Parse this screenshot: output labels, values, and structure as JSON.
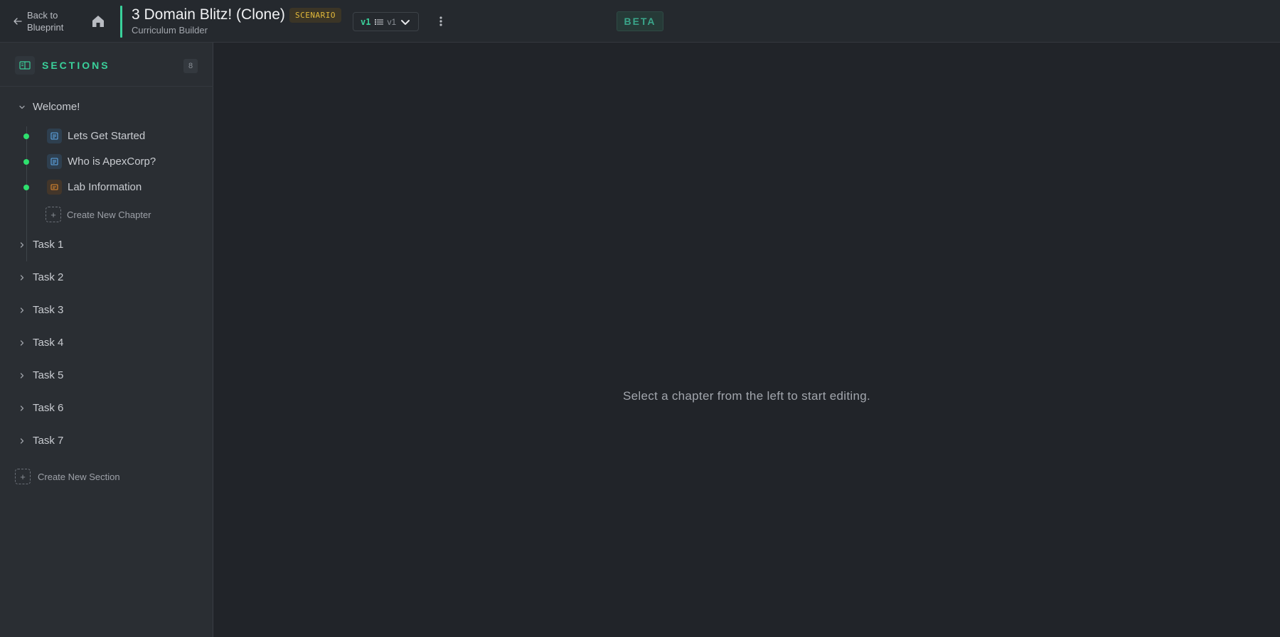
{
  "header": {
    "back_label": "Back to Blueprint",
    "title": "3 Domain Blitz! (Clone)",
    "badge": "SCENARIO",
    "subtitle": "Curriculum Builder",
    "version_current": "v1",
    "version_label": "v1",
    "beta_label": "BETA"
  },
  "sidebar": {
    "title": "SECTIONS",
    "count": "8",
    "sections": [
      {
        "label": "Welcome!",
        "expanded": true
      },
      {
        "label": "Task 1"
      },
      {
        "label": "Task 2"
      },
      {
        "label": "Task 3"
      },
      {
        "label": "Task 4"
      },
      {
        "label": "Task 5"
      },
      {
        "label": "Task 6"
      },
      {
        "label": "Task 7"
      }
    ],
    "chapters": [
      {
        "label": "Lets Get Started",
        "icon": "document-icon"
      },
      {
        "label": "Who is ApexCorp?",
        "icon": "document-icon"
      },
      {
        "label": "Lab Information",
        "icon": "lab-icon"
      }
    ],
    "create_chapter": "Create New Chapter",
    "create_section": "Create New Section"
  },
  "main": {
    "empty_message": "Select a chapter from the left to start editing."
  },
  "colors": {
    "accent": "#3ad19b",
    "badge_text": "#e2b93b",
    "status_dot": "#2ee06e",
    "background": "#212429",
    "sidebar": "#2a2e33"
  }
}
